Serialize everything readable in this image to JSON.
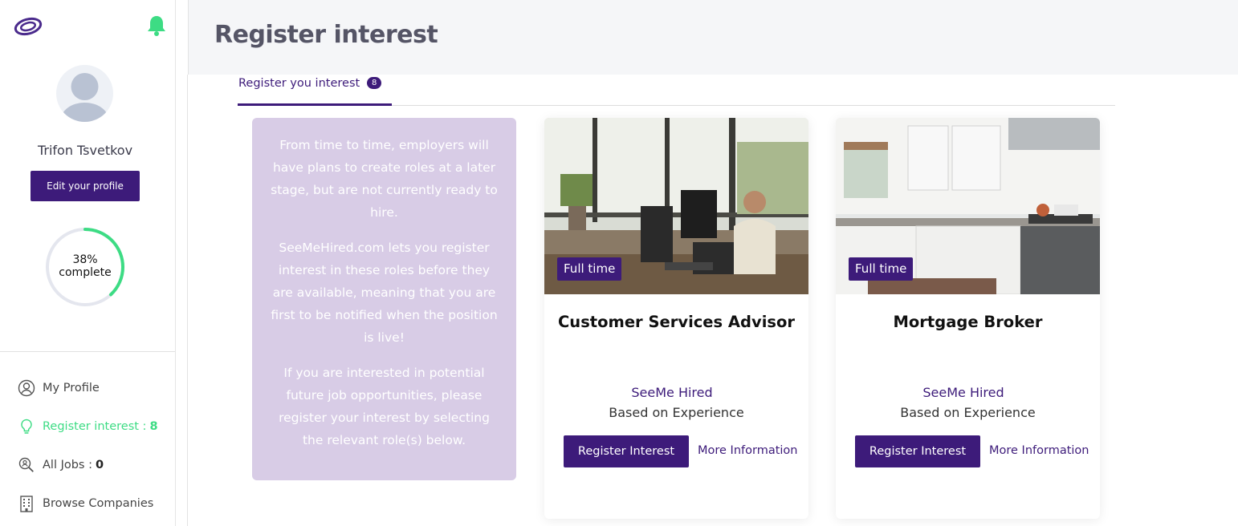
{
  "sidebar": {
    "user_name": "Trifon Tsvetkov",
    "edit_profile_label": "Edit your profile",
    "profile_completion_percent": 38,
    "profile_completion_value": "38%",
    "profile_completion_label": "complete",
    "nav": [
      {
        "label": "My Profile",
        "count": "",
        "icon": "user-circle-icon"
      },
      {
        "label": "Register interest : ",
        "count": "8",
        "icon": "lightbulb-icon"
      },
      {
        "label": "All Jobs : ",
        "count": "0",
        "icon": "search-person-icon"
      },
      {
        "label": "Browse Companies",
        "count": "",
        "icon": "building-icon"
      }
    ]
  },
  "header": {
    "title": "Register interest"
  },
  "tabs": [
    {
      "label": "Register you interest",
      "badge": "8"
    }
  ],
  "info": {
    "paragraphs": [
      "From time to time, employers will have plans to create roles at a later stage, but are not currently ready to hire.",
      "SeeMeHired.com lets you register interest in these roles before they are available, meaning that you are first to be notified when the position is live!",
      "If you are interested in potential future job opportunities, please register your interest by selecting the relevant role(s) below."
    ]
  },
  "jobs": [
    {
      "type": "Full time",
      "title": "Customer Services Advisor",
      "company": "SeeMe Hired",
      "salary": "Based on Experience",
      "register_label": "Register Interest",
      "more_label": "More Information"
    },
    {
      "type": "Full time",
      "title": "Mortgage Broker",
      "company": "SeeMe Hired",
      "salary": "Based on Experience",
      "register_label": "Register Interest",
      "more_label": "More Information"
    }
  ],
  "colors": {
    "brand": "#3d1b7a",
    "accent_green": "#3ddc84",
    "info_card_bg": "#d8cce6"
  }
}
